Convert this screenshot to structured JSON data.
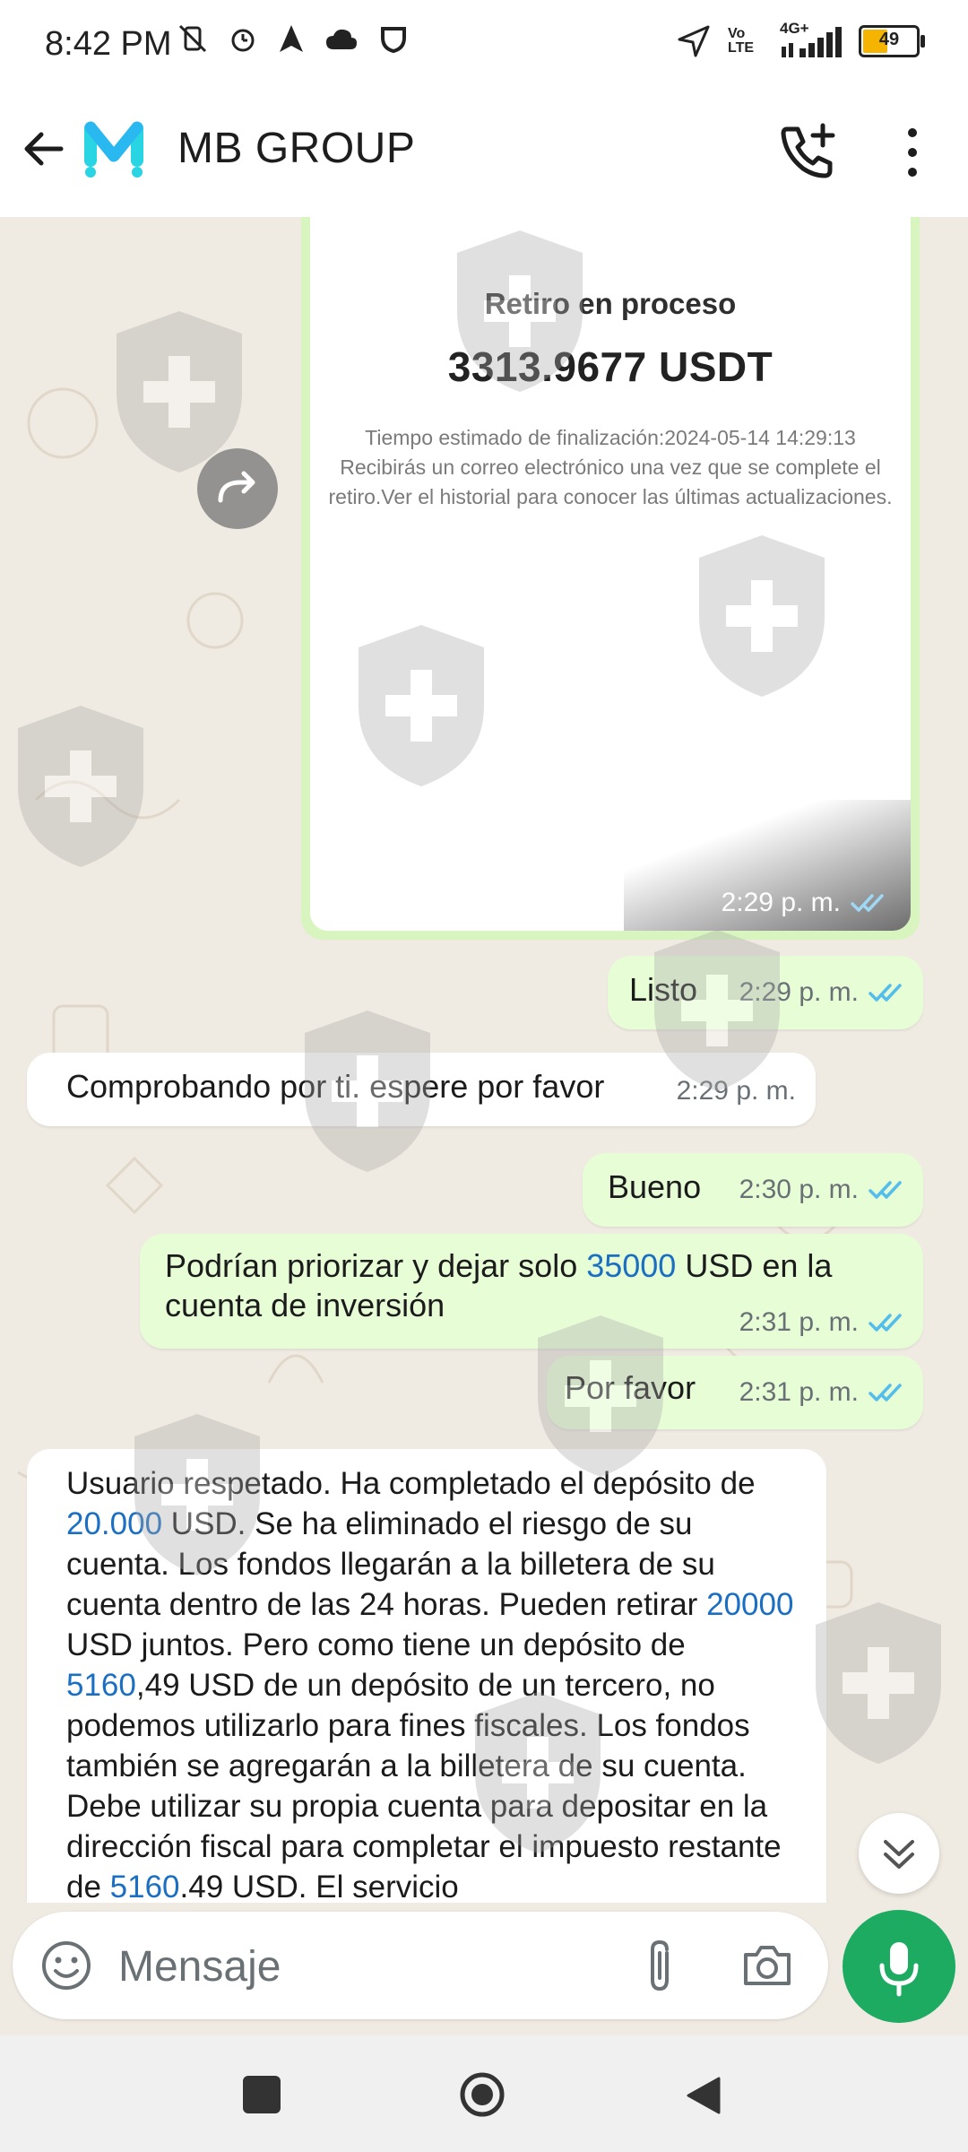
{
  "status_bar": {
    "time": "8:42 PM",
    "lte_label": "Vo LTE",
    "network": "4G+",
    "battery": "49"
  },
  "header": {
    "title": "MB GROUP"
  },
  "image_message": {
    "title": "Retiro en proceso",
    "amount": "3313.9677 USDT",
    "description": "Tiempo estimado de finalización:2024-05-14 14:29:13 Recibirás un correo electrónico una vez que se complete el retiro.Ver el historial para conocer las últimas actualizaciones.",
    "time": "2:29 p. m."
  },
  "messages": [
    {
      "text": "Listo",
      "time": "2:29 p. m."
    },
    {
      "text": "Comprobando por ti. espere por favor",
      "time": "2:29 p. m."
    },
    {
      "text": "Bueno",
      "time": "2:30 p. m."
    },
    {
      "text_a": "Podrían priorizar y dejar solo ",
      "link": "35000",
      "text_b": " USD en la",
      "text_c": "cuenta de inversión",
      "time": "2:31 p. m."
    },
    {
      "text": "Por favor",
      "time": "2:31 p. m."
    }
  ],
  "long_message": {
    "p1": "Usuario respetado. Ha completado el depósito de ",
    "n1": "20.000",
    "p2": " USD. Se ha eliminado el riesgo de su cuenta. Los fondos llegarán a la billetera de su cuenta dentro de las 24 horas. Pueden retirar ",
    "n2": "20000",
    "p3": " USD juntos. Pero como tiene un depósito de ",
    "n3": "5160",
    "p4": ",49 USD de un depósito de un tercero, no podemos utilizarlo para fines fiscales. Los fondos también se agregarán a la billetera de su cuenta. Debe utilizar su propia cuenta para depositar en la dirección fiscal para completar el impuesto restante de ",
    "n4": "5160",
    "p5": ".49 USD. El servicio"
  },
  "input": {
    "placeholder": "Mensaje"
  },
  "colors": {
    "outgoing_bubble": "#e7fdd6",
    "incoming_bubble": "#ffffff",
    "accent_green": "#1daa61",
    "tick_blue": "#53bdeb",
    "link_blue": "#1a6fc2"
  }
}
